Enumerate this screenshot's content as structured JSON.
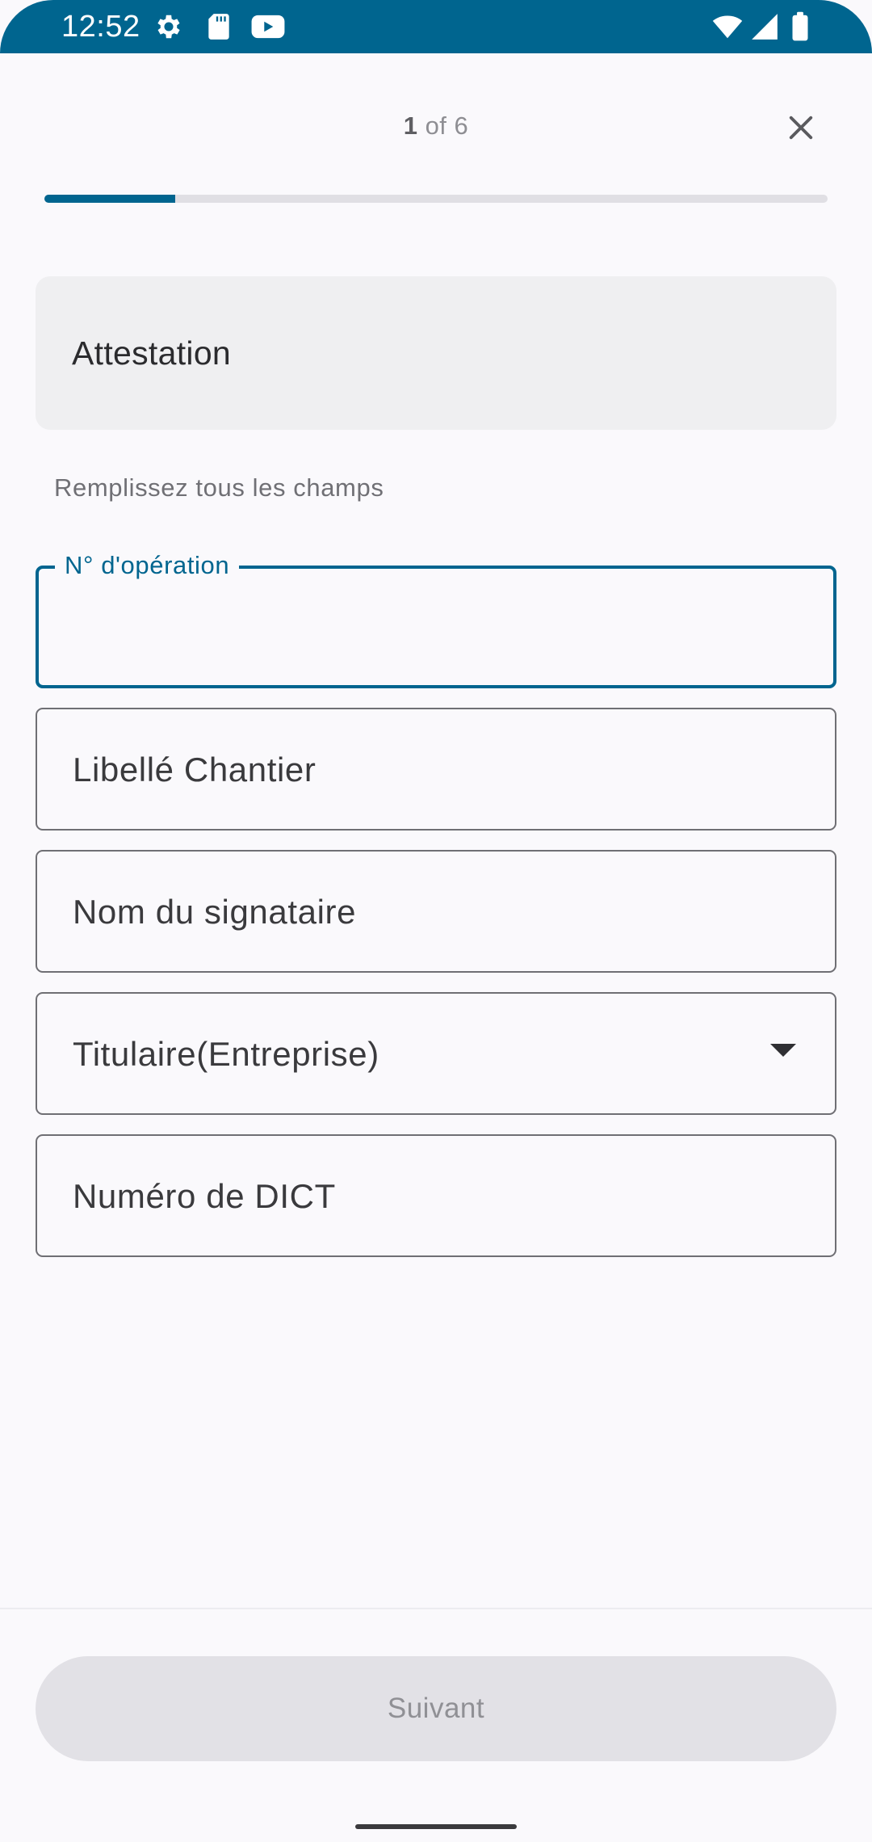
{
  "status_bar": {
    "time": "12:52",
    "icons_left": [
      "settings-icon",
      "sd-card-icon",
      "youtube-icon"
    ],
    "icons_right": [
      "wifi-icon",
      "cellular-signal-icon",
      "battery-icon"
    ],
    "background_color": "#00658f"
  },
  "header": {
    "step_current": "1",
    "step_separator": " of ",
    "step_total": "6",
    "progress_fraction": 0.1667,
    "close_icon": "close-icon"
  },
  "title_card": {
    "title": "Attestation"
  },
  "hint": "Remplissez tous les champs",
  "fields": {
    "operation_number": {
      "label": "N° d'opération",
      "value": ""
    },
    "site_label": {
      "label": "Libellé Chantier"
    },
    "signatory_name": {
      "label": "Nom du signataire"
    },
    "holder_company": {
      "label": "Titulaire(Entreprise)",
      "icon": "dropdown-arrow-icon"
    },
    "dict_number": {
      "label": "Numéro de DICT"
    }
  },
  "footer": {
    "next_label": "Suivant"
  },
  "colors": {
    "accent": "#00658f",
    "disabled_button": "#e2e1e6",
    "disabled_text": "#909095"
  }
}
